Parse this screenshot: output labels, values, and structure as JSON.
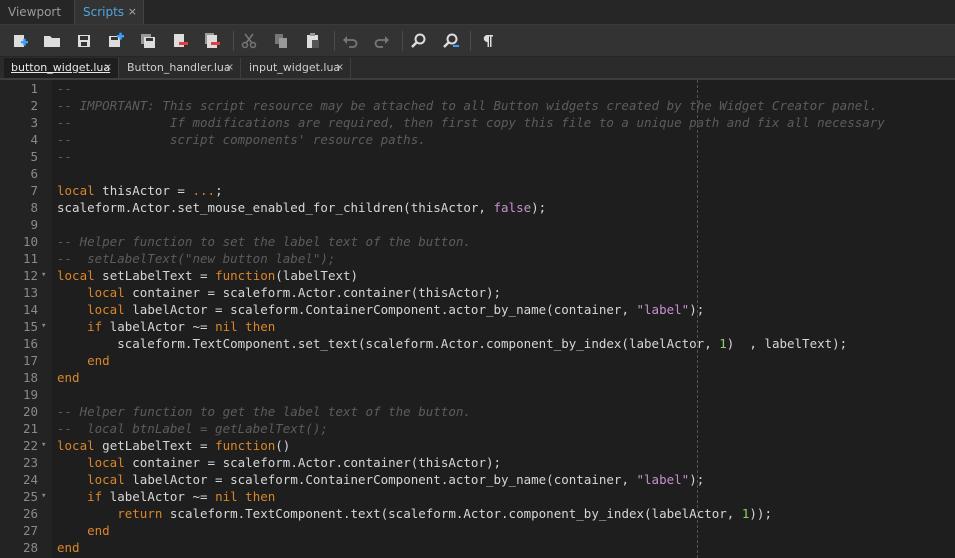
{
  "top_tabs": [
    {
      "label": "Viewport",
      "active": false
    },
    {
      "label": "Scripts",
      "active": true,
      "close": "×"
    }
  ],
  "toolbar": {
    "buttons": [
      {
        "name": "new-script-icon"
      },
      {
        "name": "open-folder-icon"
      },
      {
        "name": "save-icon"
      },
      {
        "name": "save-as-icon"
      },
      {
        "name": "save-all-icon"
      },
      {
        "name": "close-script-icon"
      },
      {
        "name": "close-all-icon"
      },
      {
        "name": "cut-icon"
      },
      {
        "name": "copy-icon"
      },
      {
        "name": "paste-icon"
      },
      {
        "name": "undo-icon"
      },
      {
        "name": "redo-icon"
      },
      {
        "name": "find-icon"
      },
      {
        "name": "find-replace-icon"
      },
      {
        "name": "show-whitespace-icon"
      }
    ]
  },
  "file_tabs": [
    {
      "label": "button_widget.lua",
      "close": "×",
      "active": true
    },
    {
      "label": "Button_handler.lua",
      "close": "×",
      "active": false
    },
    {
      "label": "input_widget.lua",
      "close": "×",
      "active": false
    }
  ],
  "editor": {
    "lines": [
      {
        "n": "1",
        "fold": "",
        "tokens": [
          {
            "t": "--",
            "c": "comment"
          }
        ]
      },
      {
        "n": "2",
        "fold": "",
        "tokens": [
          {
            "t": "-- IMPORTANT: This script resource may be attached to all Button widgets created by the Widget Creator panel.",
            "c": "comment"
          }
        ]
      },
      {
        "n": "3",
        "fold": "",
        "tokens": [
          {
            "t": "--             If modifications are required, then first copy this file to a unique path and fix all necessary",
            "c": "comment"
          }
        ]
      },
      {
        "n": "4",
        "fold": "",
        "tokens": [
          {
            "t": "--             script components' resource paths.",
            "c": "comment"
          }
        ]
      },
      {
        "n": "5",
        "fold": "",
        "tokens": [
          {
            "t": "--",
            "c": "comment"
          }
        ]
      },
      {
        "n": "6",
        "fold": "",
        "tokens": []
      },
      {
        "n": "7",
        "fold": "",
        "tokens": [
          {
            "t": "local",
            "c": "keyword"
          },
          {
            "t": " thisActor = ",
            "c": "plain"
          },
          {
            "t": "...",
            "c": "keyword"
          },
          {
            "t": ";",
            "c": "plain"
          }
        ]
      },
      {
        "n": "8",
        "fold": "",
        "tokens": [
          {
            "t": "scaleform.Actor.set_mouse_enabled_for_children(thisActor, ",
            "c": "plain"
          },
          {
            "t": "false",
            "c": "string"
          },
          {
            "t": ");",
            "c": "plain"
          }
        ]
      },
      {
        "n": "9",
        "fold": "",
        "tokens": []
      },
      {
        "n": "10",
        "fold": "",
        "tokens": [
          {
            "t": "-- Helper function to set the label text of the button.",
            "c": "comment"
          }
        ]
      },
      {
        "n": "11",
        "fold": "",
        "tokens": [
          {
            "t": "--  setLabelText(\"new button label\");",
            "c": "comment"
          }
        ]
      },
      {
        "n": "12",
        "fold": "▾",
        "tokens": [
          {
            "t": "local",
            "c": "keyword"
          },
          {
            "t": " setLabelText = ",
            "c": "plain"
          },
          {
            "t": "function",
            "c": "keyword"
          },
          {
            "t": "(labelText)",
            "c": "plain"
          }
        ]
      },
      {
        "n": "13",
        "fold": "",
        "tokens": [
          {
            "t": "    ",
            "c": "plain"
          },
          {
            "t": "local",
            "c": "keyword"
          },
          {
            "t": " container = scaleform.Actor.container(thisActor);",
            "c": "plain"
          }
        ]
      },
      {
        "n": "14",
        "fold": "",
        "tokens": [
          {
            "t": "    ",
            "c": "plain"
          },
          {
            "t": "local",
            "c": "keyword"
          },
          {
            "t": " labelActor = scaleform.ContainerComponent.actor_by_name(container, ",
            "c": "plain"
          },
          {
            "t": "\"label\"",
            "c": "string"
          },
          {
            "t": ");",
            "c": "plain"
          }
        ]
      },
      {
        "n": "15",
        "fold": "▾",
        "tokens": [
          {
            "t": "    ",
            "c": "plain"
          },
          {
            "t": "if",
            "c": "keyword"
          },
          {
            "t": " labelActor ~= ",
            "c": "plain"
          },
          {
            "t": "nil",
            "c": "keyword"
          },
          {
            "t": " ",
            "c": "plain"
          },
          {
            "t": "then",
            "c": "keyword"
          }
        ]
      },
      {
        "n": "16",
        "fold": "",
        "tokens": [
          {
            "t": "        scaleform.TextComponent.set_text(scaleform.Actor.component_by_index(labelActor, ",
            "c": "plain"
          },
          {
            "t": "1",
            "c": "number"
          },
          {
            "t": ")  , labelText);",
            "c": "plain"
          }
        ]
      },
      {
        "n": "17",
        "fold": "",
        "tokens": [
          {
            "t": "    ",
            "c": "plain"
          },
          {
            "t": "end",
            "c": "keyword"
          }
        ]
      },
      {
        "n": "18",
        "fold": "",
        "tokens": [
          {
            "t": "end",
            "c": "keyword"
          }
        ]
      },
      {
        "n": "19",
        "fold": "",
        "tokens": []
      },
      {
        "n": "20",
        "fold": "",
        "tokens": [
          {
            "t": "-- Helper function to get the label text of the button.",
            "c": "comment"
          }
        ]
      },
      {
        "n": "21",
        "fold": "",
        "tokens": [
          {
            "t": "--  local btnLabel = getLabelText();",
            "c": "comment"
          }
        ]
      },
      {
        "n": "22",
        "fold": "▾",
        "tokens": [
          {
            "t": "local",
            "c": "keyword"
          },
          {
            "t": " getLabelText = ",
            "c": "plain"
          },
          {
            "t": "function",
            "c": "keyword"
          },
          {
            "t": "()",
            "c": "plain"
          }
        ]
      },
      {
        "n": "23",
        "fold": "",
        "tokens": [
          {
            "t": "    ",
            "c": "plain"
          },
          {
            "t": "local",
            "c": "keyword"
          },
          {
            "t": " container = scaleform.Actor.container(thisActor);",
            "c": "plain"
          }
        ]
      },
      {
        "n": "24",
        "fold": "",
        "tokens": [
          {
            "t": "    ",
            "c": "plain"
          },
          {
            "t": "local",
            "c": "keyword"
          },
          {
            "t": " labelActor = scaleform.ContainerComponent.actor_by_name(container, ",
            "c": "plain"
          },
          {
            "t": "\"label\"",
            "c": "string"
          },
          {
            "t": ");",
            "c": "plain"
          }
        ]
      },
      {
        "n": "25",
        "fold": "▾",
        "tokens": [
          {
            "t": "    ",
            "c": "plain"
          },
          {
            "t": "if",
            "c": "keyword"
          },
          {
            "t": " labelActor ~= ",
            "c": "plain"
          },
          {
            "t": "nil",
            "c": "keyword"
          },
          {
            "t": " ",
            "c": "plain"
          },
          {
            "t": "then",
            "c": "keyword"
          }
        ]
      },
      {
        "n": "26",
        "fold": "",
        "tokens": [
          {
            "t": "        ",
            "c": "plain"
          },
          {
            "t": "return",
            "c": "keyword"
          },
          {
            "t": " scaleform.TextComponent.text(scaleform.Actor.component_by_index(labelActor, ",
            "c": "plain"
          },
          {
            "t": "1",
            "c": "number"
          },
          {
            "t": "));",
            "c": "plain"
          }
        ]
      },
      {
        "n": "27",
        "fold": "",
        "tokens": [
          {
            "t": "    ",
            "c": "plain"
          },
          {
            "t": "end",
            "c": "keyword"
          }
        ]
      },
      {
        "n": "28",
        "fold": "",
        "tokens": [
          {
            "t": "end",
            "c": "keyword"
          }
        ]
      }
    ]
  }
}
